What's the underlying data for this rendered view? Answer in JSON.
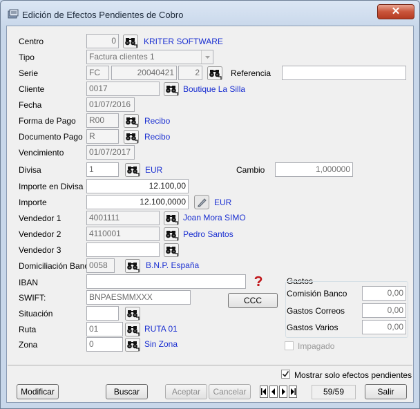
{
  "window": {
    "title": "Edición de Efectos Pendientes de Cobro",
    "close_label": "✕"
  },
  "labels": {
    "centro": "Centro",
    "tipo": "Tipo",
    "serie": "Serie",
    "referencia": "Referencia",
    "cliente": "Cliente",
    "fecha": "Fecha",
    "forma_pago": "Forma de Pago",
    "documento_pago": "Documento Pago",
    "vencimiento": "Vencimiento",
    "divisa": "Divisa",
    "cambio": "Cambio",
    "importe_divisa": "Importe en Divisa",
    "importe": "Importe",
    "vendedor1": "Vendedor 1",
    "vendedor2": "Vendedor 2",
    "vendedor3": "Vendedor 3",
    "domiciliacion": "Domiciliación Banc.",
    "iban": "IBAN",
    "swift": "SWIFT:",
    "situacion": "Situación",
    "ruta": "Ruta",
    "zona": "Zona"
  },
  "fields": {
    "centro": "0",
    "tipo": "Factura clientes 1",
    "serie": "FC",
    "serie_numero": "20040421",
    "serie_sub": "2",
    "referencia": "",
    "cliente": "0017",
    "fecha": "01/07/2016",
    "forma_pago": "R00",
    "documento_pago": "R",
    "vencimiento": "01/07/2017",
    "divisa": "1",
    "cambio": "1,000000",
    "importe_divisa": "12.100,00",
    "importe": "12.100,0000",
    "vendedor1": "4001111",
    "vendedor2": "4110001",
    "vendedor3": "",
    "domiciliacion": "0058",
    "iban": "",
    "swift": "BNPAESMMXXX",
    "situacion": "",
    "ruta": "01",
    "zona": "0"
  },
  "links": {
    "centro": "KRITER SOFTWARE",
    "cliente": "Boutique La Silla",
    "forma_pago": "Recibo",
    "documento_pago": "Recibo",
    "divisa": "EUR",
    "importe": "EUR",
    "vendedor1": "Joan Mora SIMO",
    "vendedor2": "Pedro Santos",
    "domiciliacion": "B.N.P. España",
    "ruta": "RUTA 01",
    "zona": "Sin Zona"
  },
  "gastos": {
    "title": "Gastos",
    "comision_label": "Comisión Banco",
    "comision": "0,00",
    "correos_label": "Gastos Correos",
    "correos": "0,00",
    "varios_label": "Gastos Varios",
    "varios": "0,00"
  },
  "impagado_label": "Impagado",
  "ccc_label": "CCC",
  "mostrar_label": "Mostrar solo efectos pendientes",
  "buttons": {
    "modificar": "Modificar",
    "buscar": "Buscar",
    "aceptar": "Aceptar",
    "cancelar": "Cancelar",
    "salir": "Salir"
  },
  "record_counter": "59/59",
  "colors": {
    "link": "#1a2fd1",
    "close": "#c9553b",
    "title_bar": "#c8d7ea"
  }
}
